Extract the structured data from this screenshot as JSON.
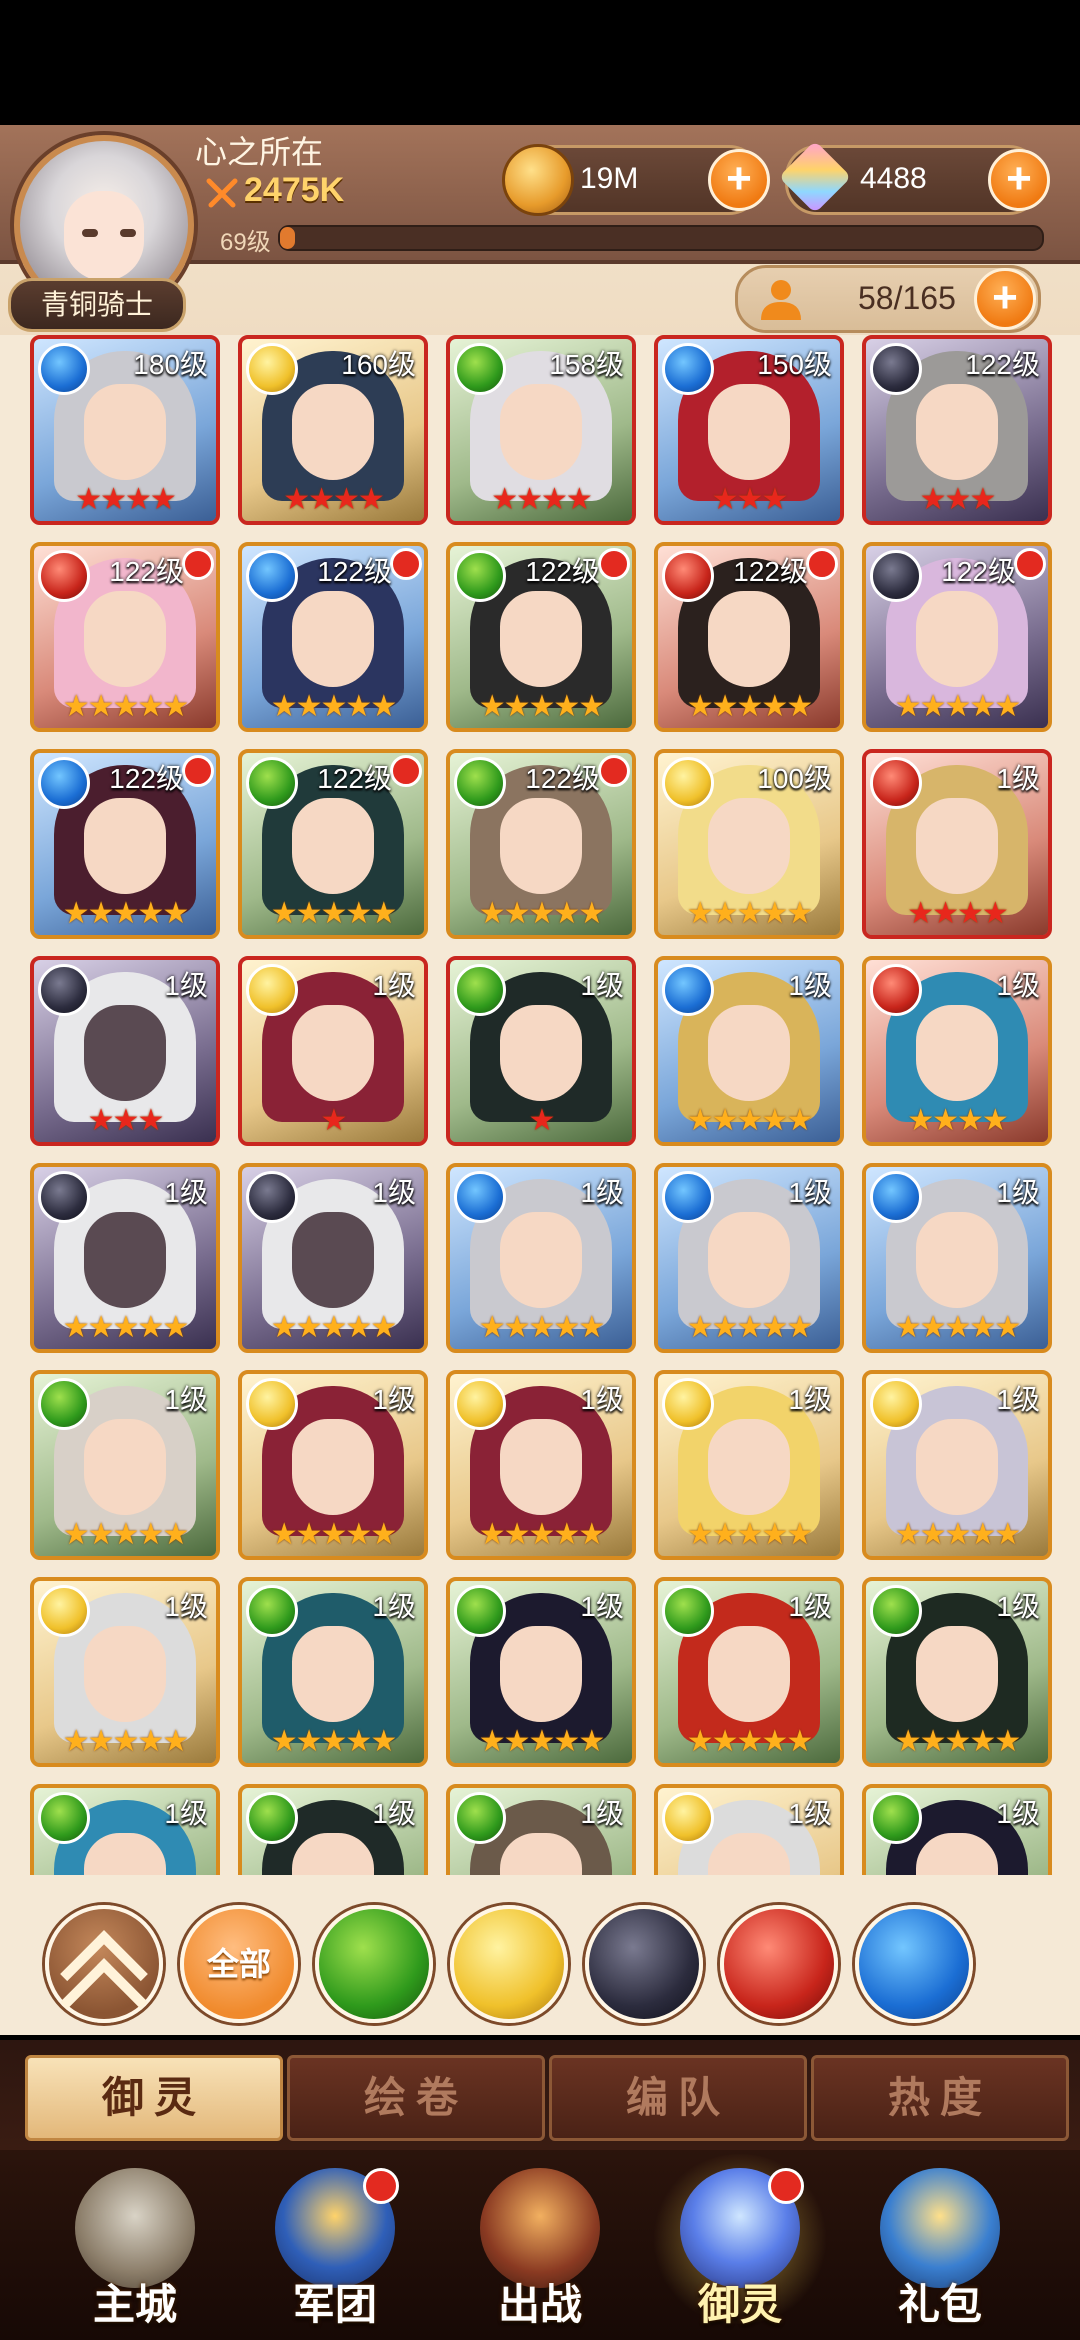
{
  "player": {
    "name": "心之所在",
    "power": "2475K",
    "level_label": "69级",
    "level_progress": 0.02,
    "rank": "青铜骑士"
  },
  "resources": {
    "coins": "19M",
    "gems": "4488",
    "roster": "58/165"
  },
  "element_colors": {
    "water": "#1b6ed4",
    "wind": "#2f9a1c",
    "light": "#f0c12b",
    "dark": "#2c2c3e",
    "fire": "#c8251b"
  },
  "heroes": [
    {
      "level": "180级",
      "element": "water",
      "stars": "★★★★",
      "star_color": "red",
      "frame": "red",
      "dot": false,
      "hair": "#c9c9cf"
    },
    {
      "level": "160级",
      "element": "light",
      "stars": "★★★★",
      "star_color": "red",
      "frame": "red",
      "dot": false,
      "hair": "#2d3d55"
    },
    {
      "level": "158级",
      "element": "wind",
      "stars": "★★★★",
      "star_color": "red",
      "frame": "red",
      "dot": false,
      "hair": "#e0dde2"
    },
    {
      "level": "150级",
      "element": "water",
      "stars": "★★★",
      "star_color": "red",
      "frame": "red",
      "dot": false,
      "hair": "#b3202c"
    },
    {
      "level": "122级",
      "element": "dark",
      "stars": "★★★",
      "star_color": "red",
      "frame": "red",
      "dot": false,
      "hair": "#9c9a98"
    },
    {
      "level": "122级",
      "element": "fire",
      "stars": "★★★★★",
      "star_color": "gold",
      "frame": "gold",
      "dot": true,
      "hair": "#f2b6cc"
    },
    {
      "level": "122级",
      "element": "water",
      "stars": "★★★★★",
      "star_color": "gold",
      "frame": "gold",
      "dot": true,
      "hair": "#2b3560"
    },
    {
      "level": "122级",
      "element": "wind",
      "stars": "★★★★★",
      "star_color": "gold",
      "frame": "gold",
      "dot": true,
      "hair": "#2a2a2a"
    },
    {
      "level": "122级",
      "element": "fire",
      "stars": "★★★★★",
      "star_color": "gold",
      "frame": "gold",
      "dot": true,
      "hair": "#2b211e"
    },
    {
      "level": "122级",
      "element": "dark",
      "stars": "★★★★★",
      "star_color": "gold",
      "frame": "gold",
      "dot": true,
      "hair": "#d9b7dd"
    },
    {
      "level": "122级",
      "element": "water",
      "stars": "★★★★★",
      "star_color": "gold",
      "frame": "gold",
      "dot": true,
      "hair": "#4b1e2e"
    },
    {
      "level": "122级",
      "element": "wind",
      "stars": "★★★★★",
      "star_color": "gold",
      "frame": "gold",
      "dot": true,
      "hair": "#203a3a"
    },
    {
      "level": "122级",
      "element": "wind",
      "stars": "★★★★★",
      "star_color": "gold",
      "frame": "gold",
      "dot": true,
      "hair": "#8b7460"
    },
    {
      "level": "100级",
      "element": "light",
      "stars": "★★★★★",
      "star_color": "gold",
      "frame": "gold",
      "dot": false,
      "hair": "#f2dc8a"
    },
    {
      "level": "1级",
      "element": "fire",
      "stars": "★★★★",
      "star_color": "red",
      "frame": "red",
      "dot": false,
      "hair": "#d7b56a"
    },
    {
      "level": "1级",
      "element": "dark",
      "stars": "★★★",
      "star_color": "red",
      "frame": "red",
      "dot": false,
      "hair": "#e8e8ea"
    },
    {
      "level": "1级",
      "element": "light",
      "stars": "★",
      "star_color": "red",
      "frame": "red",
      "dot": false,
      "hair": "#8a2236"
    },
    {
      "level": "1级",
      "element": "wind",
      "stars": "★",
      "star_color": "red",
      "frame": "red",
      "dot": false,
      "hair": "#1f2a28"
    },
    {
      "level": "1级",
      "element": "water",
      "stars": "★★★★★",
      "star_color": "gold",
      "frame": "gold",
      "dot": false,
      "hair": "#d9b45a"
    },
    {
      "level": "1级",
      "element": "fire",
      "stars": "★★★★",
      "star_color": "gold",
      "frame": "gold",
      "dot": false,
      "hair": "#2f8bb3"
    },
    {
      "level": "1级",
      "element": "dark",
      "stars": "★★★★★",
      "star_color": "gold",
      "frame": "gold",
      "dot": false,
      "hair": "#e8e8ea"
    },
    {
      "level": "1级",
      "element": "dark",
      "stars": "★★★★★",
      "star_color": "gold",
      "frame": "gold",
      "dot": false,
      "hair": "#e8e8ea"
    },
    {
      "level": "1级",
      "element": "water",
      "stars": "★★★★★",
      "star_color": "gold",
      "frame": "gold",
      "dot": false,
      "hair": "#c9c9cf"
    },
    {
      "level": "1级",
      "element": "water",
      "stars": "★★★★★",
      "star_color": "gold",
      "frame": "gold",
      "dot": false,
      "hair": "#c9c9cf"
    },
    {
      "level": "1级",
      "element": "water",
      "stars": "★★★★★",
      "star_color": "gold",
      "frame": "gold",
      "dot": false,
      "hair": "#c9c9cf"
    },
    {
      "level": "1级",
      "element": "wind",
      "stars": "★★★★★",
      "star_color": "gold",
      "frame": "gold",
      "dot": false,
      "hair": "#d8d0c8"
    },
    {
      "level": "1级",
      "element": "light",
      "stars": "★★★★★",
      "star_color": "gold",
      "frame": "gold",
      "dot": false,
      "hair": "#8a2236"
    },
    {
      "level": "1级",
      "element": "light",
      "stars": "★★★★★",
      "star_color": "gold",
      "frame": "gold",
      "dot": false,
      "hair": "#8a2236"
    },
    {
      "level": "1级",
      "element": "light",
      "stars": "★★★★★",
      "star_color": "gold",
      "frame": "gold",
      "dot": false,
      "hair": "#f2d36a"
    },
    {
      "level": "1级",
      "element": "light",
      "stars": "★★★★★",
      "star_color": "gold",
      "frame": "gold",
      "dot": false,
      "hair": "#c8c4d6"
    },
    {
      "level": "1级",
      "element": "light",
      "stars": "★★★★★",
      "star_color": "gold",
      "frame": "gold",
      "dot": false,
      "hair": "#dcdcdc"
    },
    {
      "level": "1级",
      "element": "wind",
      "stars": "★★★★★",
      "star_color": "gold",
      "frame": "gold",
      "dot": false,
      "hair": "#1f5c6a"
    },
    {
      "level": "1级",
      "element": "wind",
      "stars": "★★★★★",
      "star_color": "gold",
      "frame": "gold",
      "dot": false,
      "hair": "#1c1a2e"
    },
    {
      "level": "1级",
      "element": "wind",
      "stars": "★★★★★",
      "star_color": "gold",
      "frame": "gold",
      "dot": false,
      "hair": "#c32a1c"
    },
    {
      "level": "1级",
      "element": "wind",
      "stars": "★★★★★",
      "star_color": "gold",
      "frame": "gold",
      "dot": false,
      "hair": "#1e2a22"
    },
    {
      "level": "1级",
      "element": "wind",
      "stars": "",
      "star_color": "gold",
      "frame": "gold",
      "dot": false,
      "hair": "#2f8bb3"
    },
    {
      "level": "1级",
      "element": "wind",
      "stars": "",
      "star_color": "gold",
      "frame": "gold",
      "dot": false,
      "hair": "#1f2a28"
    },
    {
      "level": "1级",
      "element": "wind",
      "stars": "",
      "star_color": "gold",
      "frame": "gold",
      "dot": false,
      "hair": "#6b5a4a"
    },
    {
      "level": "1级",
      "element": "light",
      "stars": "",
      "star_color": "gold",
      "frame": "gold",
      "dot": false,
      "hair": "#dcdcdc"
    },
    {
      "level": "1级",
      "element": "wind",
      "stars": "",
      "star_color": "gold",
      "frame": "gold",
      "dot": false,
      "hair": "#1c1a2e"
    }
  ],
  "filters": {
    "collapse_icon": "chevron-up-icon",
    "all_label": "全部",
    "elements": [
      "wind",
      "light",
      "dark",
      "fire",
      "water"
    ]
  },
  "tabs": [
    {
      "label": "御灵",
      "active": true
    },
    {
      "label": "绘卷",
      "active": false
    },
    {
      "label": "编队",
      "active": false
    },
    {
      "label": "热度",
      "active": false
    }
  ],
  "nav": [
    {
      "label": "主城",
      "icon": "castle-icon",
      "active": false,
      "dot": false
    },
    {
      "label": "军团",
      "icon": "guild-shield-icon",
      "active": false,
      "dot": true
    },
    {
      "label": "出战",
      "icon": "battle-gate-icon",
      "active": false,
      "dot": false
    },
    {
      "label": "御灵",
      "icon": "crystal-icon",
      "active": true,
      "dot": true
    },
    {
      "label": "礼包",
      "icon": "shop-icon",
      "active": false,
      "dot": false
    }
  ]
}
